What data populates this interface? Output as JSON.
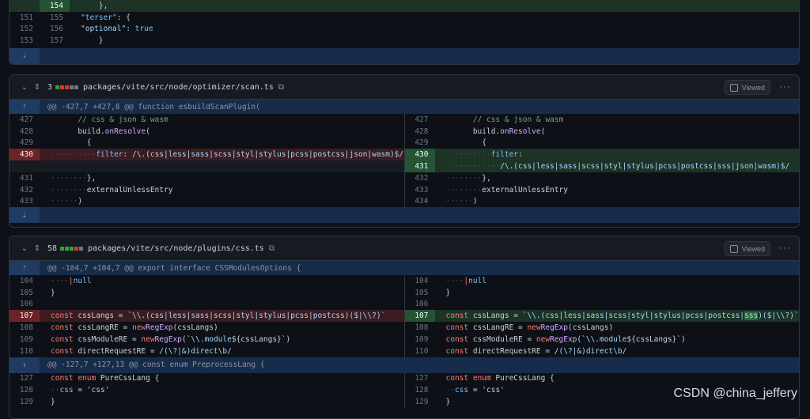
{
  "top": {
    "rows": [
      {
        "old": "",
        "new": "154",
        "code": "    },",
        "type": "add"
      },
      {
        "old": "151",
        "new": "155",
        "code": "    \"terser\": {",
        "type": "ctx"
      },
      {
        "old": "152",
        "new": "156",
        "code": "      \"optional\": true",
        "type": "ctx"
      },
      {
        "old": "153",
        "new": "157",
        "code": "    }",
        "type": "ctx"
      }
    ]
  },
  "file1": {
    "count": "3",
    "path": "packages/vite/src/node/optimizer/scan.ts",
    "viewed_label": "Viewed",
    "hunk": "@@ -427,7 +427,8 @@ function esbuildScanPlugin(",
    "left": [
      {
        "n": "427",
        "code": "      // css & json & wasm"
      },
      {
        "n": "428",
        "code": "      build.onResolve("
      },
      {
        "n": "429",
        "code": "        {"
      },
      {
        "n": "430",
        "code": "          filter: /\\.(css|less|sass|scss|styl|stylus|pcss|postcss|json|wasm)$/"
      },
      {
        "n": "",
        "code": ""
      },
      {
        "n": "431",
        "code": "        },"
      },
      {
        "n": "432",
        "code": "        externalUnlessEntry"
      },
      {
        "n": "433",
        "code": "      )"
      }
    ],
    "right": [
      {
        "n": "427",
        "code": "      // css & json & wasm"
      },
      {
        "n": "428",
        "code": "      build.onResolve("
      },
      {
        "n": "429",
        "code": "        {"
      },
      {
        "n": "430",
        "code": "          filter:"
      },
      {
        "n": "431",
        "code": "            /\\.(css|less|sass|scss|styl|stylus|pcss|postcss|sss|json|wasm)$/"
      },
      {
        "n": "432",
        "code": "        },"
      },
      {
        "n": "433",
        "code": "        externalUnlessEntry"
      },
      {
        "n": "434",
        "code": "      )"
      }
    ]
  },
  "file2": {
    "count": "58",
    "path": "packages/vite/src/node/plugins/css.ts",
    "viewed_label": "Viewed",
    "hunk1": "@@ -104,7 +104,7 @@ export interface CSSModulesOptions {",
    "hunk2": "@@ -127,7 +127,13 @@ const enum PreprocessLang {",
    "left": [
      {
        "n": "104",
        "code": "    | null"
      },
      {
        "n": "105",
        "code": "}"
      },
      {
        "n": "106",
        "code": ""
      },
      {
        "n": "107",
        "code": "const cssLangs = `\\\\.(css|less|sass|scss|styl|stylus|pcss|postcss)($|\\\\?)`"
      },
      {
        "n": "108",
        "code": "const cssLangRE = new RegExp(cssLangs)"
      },
      {
        "n": "109",
        "code": "const cssModuleRE = new RegExp(`\\\\.module${cssLangs}`)"
      },
      {
        "n": "110",
        "code": "const directRequestRE = /(\\?|&)direct\\b/"
      }
    ],
    "right": [
      {
        "n": "104",
        "code": "    | null"
      },
      {
        "n": "105",
        "code": "}"
      },
      {
        "n": "106",
        "code": ""
      },
      {
        "n": "107",
        "code": "const cssLangs = `\\\\.(css|less|sass|scss|styl|stylus|pcss|postcss|sss)($|\\\\?)`"
      },
      {
        "n": "108",
        "code": "const cssLangRE = new RegExp(cssLangs)"
      },
      {
        "n": "109",
        "code": "const cssModuleRE = new RegExp(`\\\\.module${cssLangs}`)"
      },
      {
        "n": "110",
        "code": "const directRequestRE = /(\\?|&)direct\\b/"
      }
    ],
    "left2": [
      {
        "n": "127",
        "code": "const enum PureCssLang {"
      },
      {
        "n": "128",
        "code": "  css = 'css'"
      },
      {
        "n": "129",
        "code": "}"
      }
    ],
    "right2": [
      {
        "n": "127",
        "code": "const enum PureCssLang {"
      },
      {
        "n": "128",
        "code": "  css = 'css'"
      },
      {
        "n": "129",
        "code": "}"
      }
    ]
  },
  "watermark": "CSDN @china_jeffery",
  "colors": {
    "added": "#2ea043",
    "deleted": "#da3633",
    "hunk_bg": "#172c4a"
  }
}
